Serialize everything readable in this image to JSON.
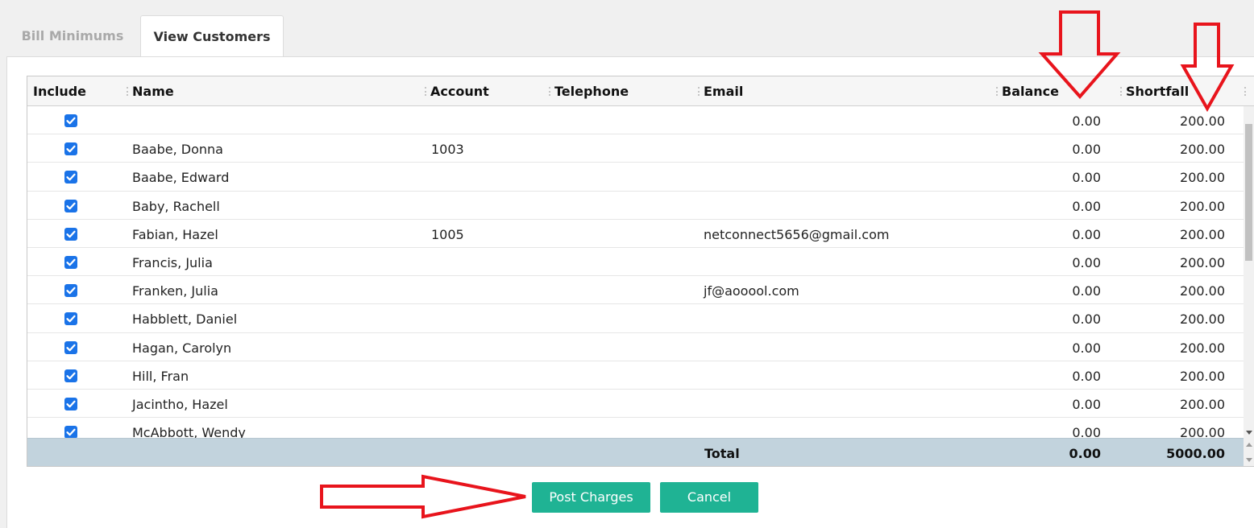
{
  "tabs": [
    {
      "label": "Bill Minimums",
      "active": false
    },
    {
      "label": "View Customers",
      "active": true
    }
  ],
  "grid": {
    "columns": {
      "include": "Include",
      "name": "Name",
      "account": "Account",
      "telephone": "Telephone",
      "email": "Email",
      "balance": "Balance",
      "shortfall": "Shortfall"
    },
    "rows": [
      {
        "include": true,
        "name": "",
        "account": "",
        "telephone": "",
        "email": "",
        "balance": "0.00",
        "shortfall": "200.00"
      },
      {
        "include": true,
        "name": "Baabe, Donna",
        "account": "1003",
        "telephone": "",
        "email": "",
        "balance": "0.00",
        "shortfall": "200.00"
      },
      {
        "include": true,
        "name": "Baabe, Edward",
        "account": "",
        "telephone": "",
        "email": "",
        "balance": "0.00",
        "shortfall": "200.00"
      },
      {
        "include": true,
        "name": "Baby, Rachell",
        "account": "",
        "telephone": "",
        "email": "",
        "balance": "0.00",
        "shortfall": "200.00"
      },
      {
        "include": true,
        "name": "Fabian, Hazel",
        "account": "1005",
        "telephone": "",
        "email": "netconnect5656@gmail.com",
        "balance": "0.00",
        "shortfall": "200.00"
      },
      {
        "include": true,
        "name": "Francis, Julia",
        "account": "",
        "telephone": "",
        "email": "",
        "balance": "0.00",
        "shortfall": "200.00"
      },
      {
        "include": true,
        "name": "Franken, Julia",
        "account": "",
        "telephone": "",
        "email": "jf@aooool.com",
        "balance": "0.00",
        "shortfall": "200.00"
      },
      {
        "include": true,
        "name": "Habblett, Daniel",
        "account": "",
        "telephone": "",
        "email": "",
        "balance": "0.00",
        "shortfall": "200.00"
      },
      {
        "include": true,
        "name": "Hagan, Carolyn",
        "account": "",
        "telephone": "",
        "email": "",
        "balance": "0.00",
        "shortfall": "200.00"
      },
      {
        "include": true,
        "name": "Hill, Fran",
        "account": "",
        "telephone": "",
        "email": "",
        "balance": "0.00",
        "shortfall": "200.00"
      },
      {
        "include": true,
        "name": "Jacintho, Hazel",
        "account": "",
        "telephone": "",
        "email": "",
        "balance": "0.00",
        "shortfall": "200.00"
      },
      {
        "include": true,
        "name": "McAbbott, Wendy",
        "account": "",
        "telephone": "",
        "email": "",
        "balance": "0.00",
        "shortfall": "200.00"
      }
    ],
    "footer": {
      "label": "Total",
      "balance": "0.00",
      "shortfall": "5000.00"
    }
  },
  "buttons": {
    "post": "Post Charges",
    "cancel": "Cancel"
  },
  "colors": {
    "accent": "#1fb394",
    "checkbox": "#1a73e8",
    "footer": "#c2d3dd",
    "annotation": "#e8141c"
  }
}
